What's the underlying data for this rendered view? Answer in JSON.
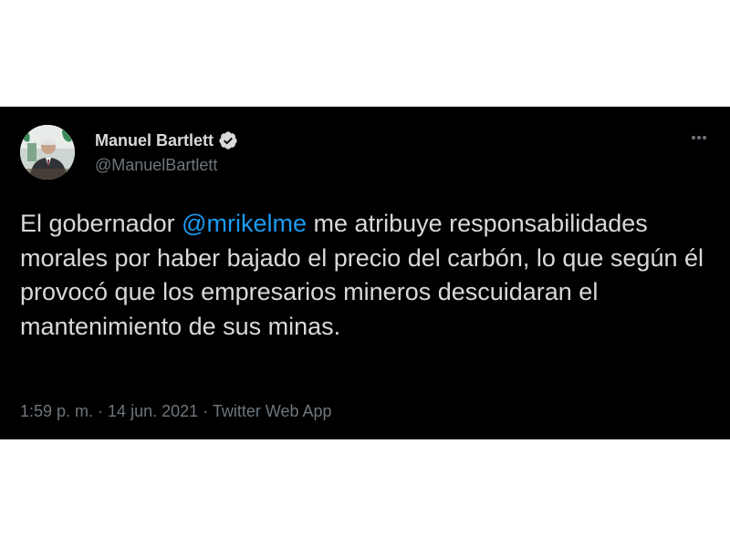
{
  "author": {
    "name": "Manuel Bartlett",
    "handle": "@ManuelBartlett",
    "verified": true
  },
  "tweet": {
    "text_before": "El gobernador ",
    "mention": "@mrikelme",
    "text_after": " me atribuye responsabilidades morales por haber bajado el precio del carbón, lo que según él provocó que los empresarios mineros descuidaran el mantenimiento de sus minas."
  },
  "meta": {
    "time": "1:59 p. m.",
    "separator": " · ",
    "date": "14 jun. 2021",
    "source": "Twitter Web App"
  },
  "icons": {
    "verified": "verified-badge-icon",
    "more": "more-options-icon"
  },
  "colors": {
    "background": "#000000",
    "text": "#d9d9d9",
    "secondary": "#6e767d",
    "accent": "#1d9bf0"
  }
}
